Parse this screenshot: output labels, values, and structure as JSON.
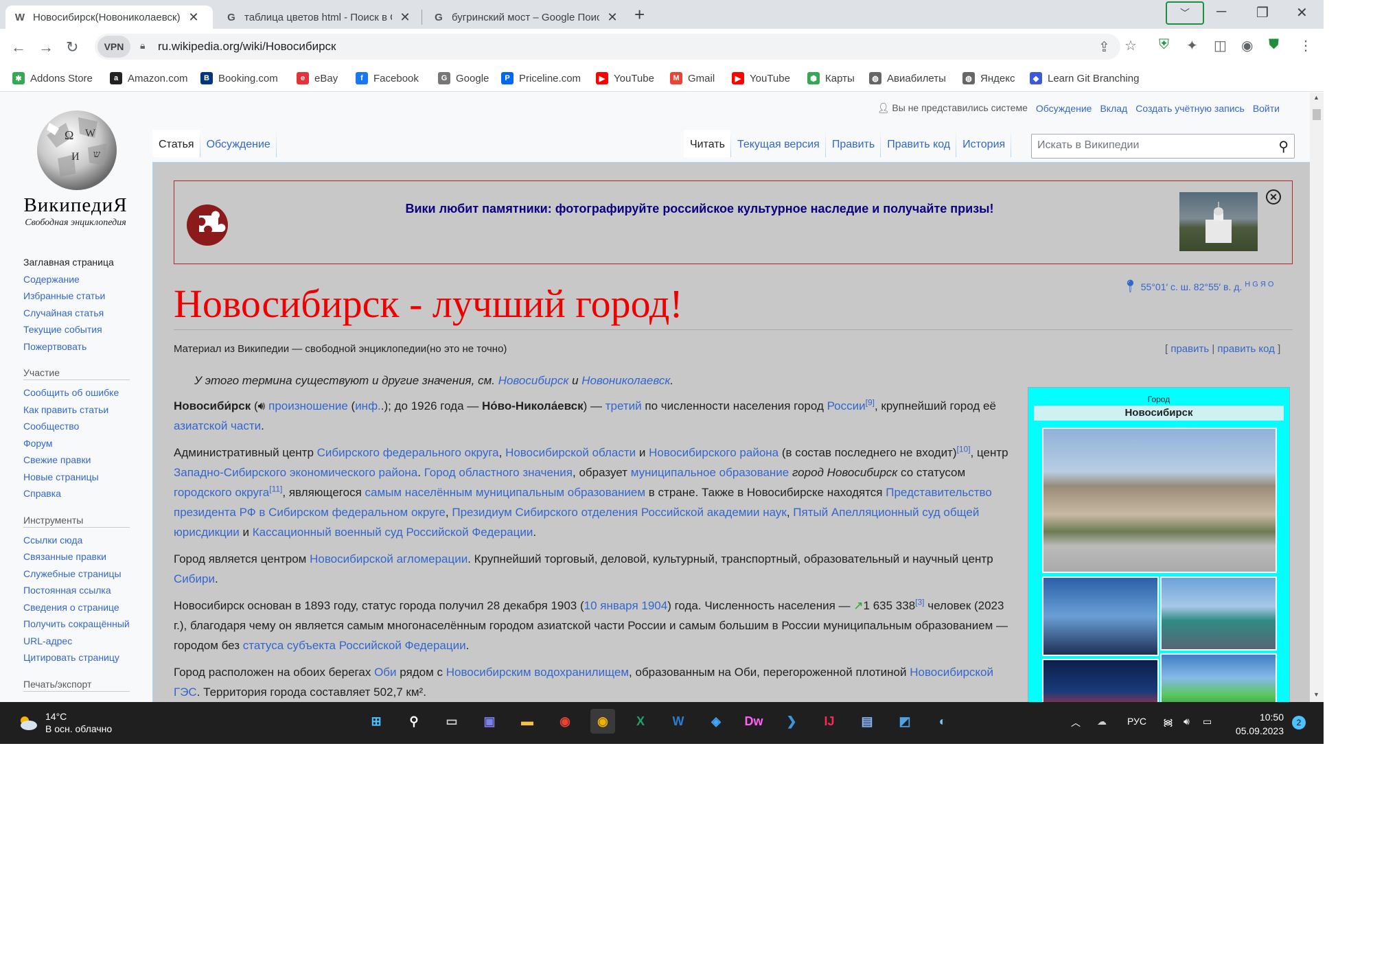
{
  "browser": {
    "tabs": [
      {
        "icon": "W",
        "title": "Новосибирск(Новониколаевск) - В",
        "active": true
      },
      {
        "icon": "G",
        "title": "таблица цветов html - Поиск в G",
        "active": false
      },
      {
        "icon": "G",
        "title": "бугринский мост – Google Поиск",
        "active": false
      }
    ],
    "new_tab": "+",
    "window": {
      "minimize": "─",
      "maximize": "❐",
      "close": "✕"
    },
    "address": {
      "vpn": "VPN",
      "url": "ru.wikipedia.org/wiki/Новосибирск"
    },
    "bookmarks": [
      {
        "label": "Addons Store",
        "icon": "✱",
        "color": "#34a853"
      },
      {
        "label": "Amazon.com",
        "icon": "a",
        "color": "#222222"
      },
      {
        "label": "Booking.com",
        "icon": "B",
        "color": "#003580"
      },
      {
        "label": "eBay",
        "icon": "e",
        "color": "#e53238"
      },
      {
        "label": "Facebook",
        "icon": "f",
        "color": "#1877f2"
      },
      {
        "label": "Google",
        "icon": "G",
        "color": "#777777"
      },
      {
        "label": "Priceline.com",
        "icon": "P",
        "color": "#0068ef"
      },
      {
        "label": "YouTube",
        "icon": "▶",
        "color": "#ff0000"
      },
      {
        "label": "Gmail",
        "icon": "M",
        "color": "#ea4335"
      },
      {
        "label": "YouTube",
        "icon": "▶",
        "color": "#ff0000"
      },
      {
        "label": "Карты",
        "icon": "⬢",
        "color": "#34a853"
      },
      {
        "label": "Авиабилеты",
        "icon": "◍",
        "color": "#666666"
      },
      {
        "label": "Яндекс",
        "icon": "◍",
        "color": "#666666"
      },
      {
        "label": "Learn Git Branching",
        "icon": "◆",
        "color": "#3b5bdb"
      }
    ]
  },
  "wiki": {
    "wordmark": "ВикипедиЯ",
    "tagline": "Свободная энциклопедия",
    "personal": {
      "anon": "Вы не представились системе",
      "links": [
        "Обсуждение",
        "Вклад",
        "Создать учётную запись",
        "Войти"
      ]
    },
    "sidebar": {
      "nav": [
        "Заглавная страница",
        "Содержание",
        "Избранные статьи",
        "Случайная статья",
        "Текущие события",
        "Пожертвовать"
      ],
      "participation_head": "Участие",
      "participation": [
        "Сообщить об ошибке",
        "Как править статьи",
        "Сообщество",
        "Форум",
        "Свежие правки",
        "Новые страницы",
        "Справка"
      ],
      "tools_head": "Инструменты",
      "tools": [
        "Ссылки сюда",
        "Связанные правки",
        "Служебные страницы",
        "Постоянная ссылка",
        "Сведения о странице",
        "Получить сокращённый URL-адрес",
        "Цитировать страницу"
      ],
      "print_head": "Печать/экспорт"
    },
    "tabs_left": [
      "Статья",
      "Обсуждение"
    ],
    "tabs_right": [
      "Читать",
      "Текущая версия",
      "Править",
      "Править код",
      "История"
    ],
    "search_placeholder": "Искать в Википедии",
    "banner": "Вики любит памятники: фотографируйте российское культурное наследие и получайте призы!",
    "coords": {
      "text": "55°01′ с. ш. 82°55′ в. д.",
      "sup": "H G Я O"
    },
    "title": "Новосибирск - лучший город!",
    "sitesub": "Материал из Википедии — свободной энциклопедии(но это не точно)",
    "editlinks": {
      "open": "[ ",
      "edit": "править",
      "sep": " | ",
      "editcode": "править код",
      "close": " ]"
    },
    "hatnote": {
      "text": "У этого термина существуют и другие значения, см. ",
      "link1": "Новосибирск",
      "and": " и ",
      "link2": "Новониколаевск",
      "end": "."
    },
    "infobox": {
      "above": "Город",
      "title": "Новосибирск"
    }
  },
  "taskbar": {
    "weather": {
      "temp": "14°C",
      "desc": "В осн. облачно"
    },
    "lang": "РУС",
    "time": "10:50",
    "date": "05.09.2023",
    "notifications": "2",
    "apps": [
      {
        "icon": "⊞",
        "color": "#4cc2ff",
        "name": "start"
      },
      {
        "icon": "⚲",
        "color": "#ffffff",
        "name": "search"
      },
      {
        "icon": "▭",
        "color": "#cccccc",
        "name": "task-view"
      },
      {
        "icon": "▣",
        "color": "#7b83eb",
        "name": "teams"
      },
      {
        "icon": "▬",
        "color": "#f8c33c",
        "name": "explorer"
      },
      {
        "icon": "◉",
        "color": "#ea4335",
        "name": "chrome"
      },
      {
        "icon": "◉",
        "color": "#f0b400",
        "name": "browser"
      },
      {
        "icon": "X",
        "color": "#21a366",
        "name": "excel"
      },
      {
        "icon": "W",
        "color": "#2b7cd3",
        "name": "word"
      },
      {
        "icon": "◈",
        "color": "#40a9ff",
        "name": "defender"
      },
      {
        "icon": "Dw",
        "color": "#ff61f6",
        "name": "dreamweaver"
      },
      {
        "icon": "❯",
        "color": "#3a96dd",
        "name": "vscode"
      },
      {
        "icon": "IJ",
        "color": "#fe2857",
        "name": "intellij"
      },
      {
        "icon": "▤",
        "color": "#8ab4f8",
        "name": "notepad"
      },
      {
        "icon": "◩",
        "color": "#4ea3e6",
        "name": "photos"
      },
      {
        "icon": "◐",
        "color": "#77c4f0",
        "name": "paint"
      }
    ]
  }
}
